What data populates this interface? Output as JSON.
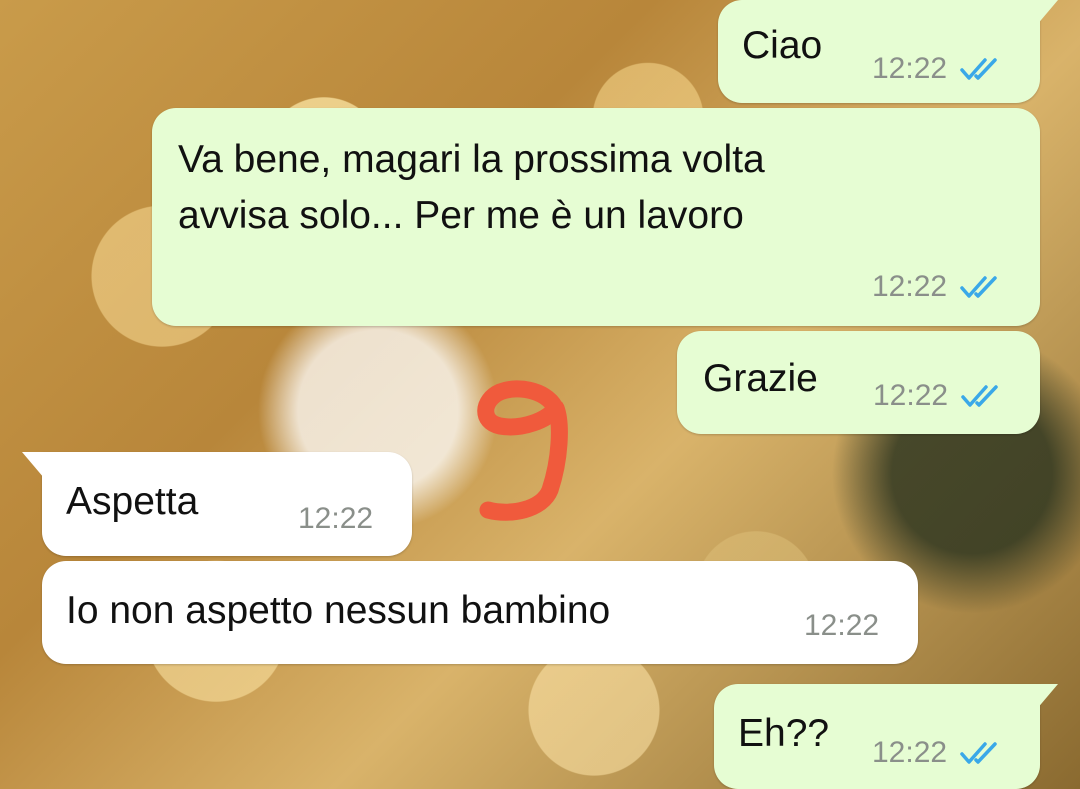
{
  "chat": {
    "messages": [
      {
        "direction": "outgoing",
        "text": "Ciao",
        "time": "12:22",
        "status": "read-double-tick-icon"
      },
      {
        "direction": "outgoing",
        "text": "Va bene, magari la prossima volta\navvisa solo... Per me è un lavoro",
        "time": "12:22",
        "status": "read-double-tick-icon"
      },
      {
        "direction": "outgoing",
        "text": "Grazie",
        "time": "12:22",
        "status": "read-double-tick-icon"
      },
      {
        "direction": "incoming",
        "text": "Aspetta",
        "time": "12:22"
      },
      {
        "direction": "incoming",
        "text": "Io non aspetto nessun bambino",
        "time": "12:22"
      },
      {
        "direction": "outgoing",
        "text": "Eh??",
        "time": "12:22",
        "status": "read-double-tick-icon"
      }
    ]
  },
  "annotation": {
    "text": "9",
    "color": "#f05a3c"
  },
  "colors": {
    "outgoing_bubble": "#e6fdd3",
    "incoming_bubble": "#ffffff",
    "read_tick": "#3aa8e8",
    "timestamp": "#8a8f8a"
  }
}
